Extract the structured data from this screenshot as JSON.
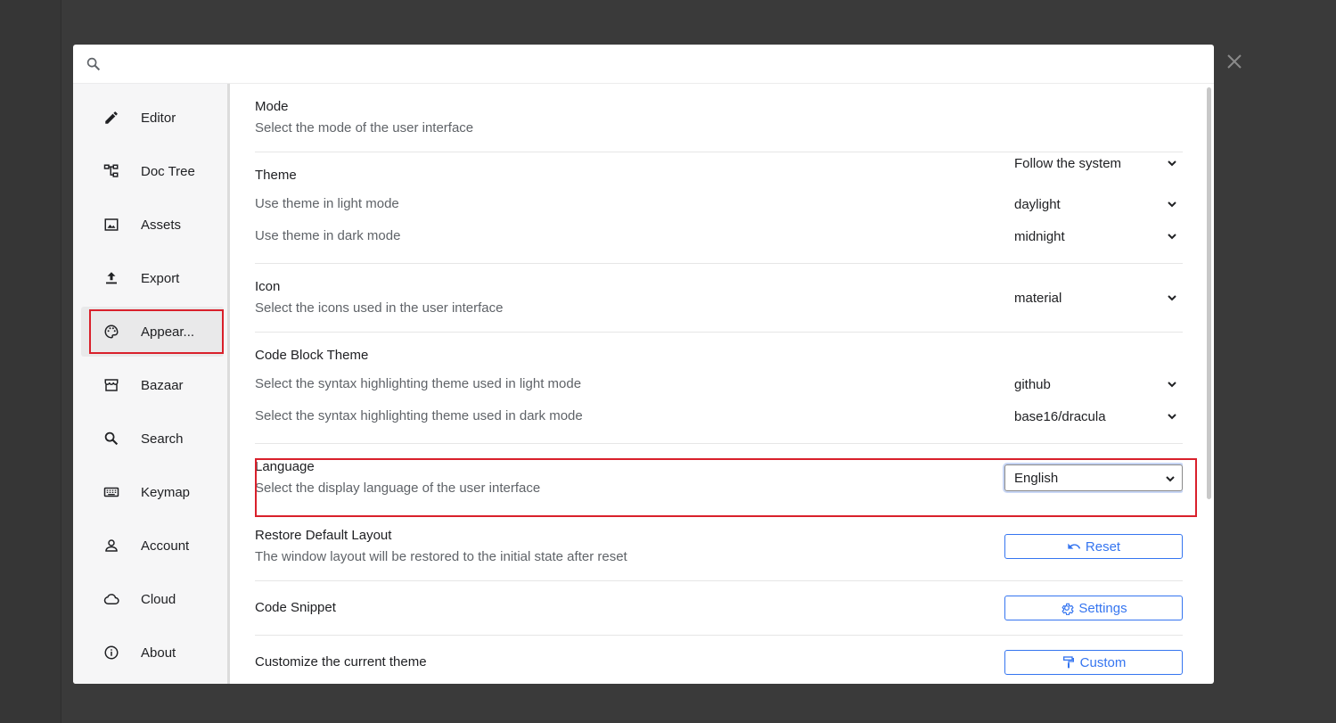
{
  "search": {
    "placeholder": ""
  },
  "sidebar": {
    "items": [
      {
        "label": "Editor",
        "icon": "pencil-icon"
      },
      {
        "label": "Doc Tree",
        "icon": "doc-tree-icon"
      },
      {
        "label": "Assets",
        "icon": "image-icon"
      },
      {
        "label": "Export",
        "icon": "export-icon"
      },
      {
        "label": "Appear...",
        "icon": "palette-icon",
        "active": true
      },
      {
        "label": "Bazaar",
        "icon": "store-icon"
      },
      {
        "label": "Search",
        "icon": "search-icon"
      },
      {
        "label": "Keymap",
        "icon": "keyboard-icon"
      },
      {
        "label": "Account",
        "icon": "account-icon"
      },
      {
        "label": "Cloud",
        "icon": "cloud-icon"
      },
      {
        "label": "About",
        "icon": "info-icon"
      }
    ]
  },
  "settings": {
    "mode": {
      "title": "Mode",
      "desc": "Select the mode of the user interface",
      "value": "Follow the system"
    },
    "theme": {
      "title": "Theme",
      "light_desc": "Use theme in light mode",
      "light_value": "daylight",
      "dark_desc": "Use theme in dark mode",
      "dark_value": "midnight"
    },
    "icon": {
      "title": "Icon",
      "desc": "Select the icons used in the user interface",
      "value": "material"
    },
    "code_block": {
      "title": "Code Block Theme",
      "light_desc": "Select the syntax highlighting theme used in light mode",
      "light_value": "github",
      "dark_desc": "Select the syntax highlighting theme used in dark mode",
      "dark_value": "base16/dracula"
    },
    "language": {
      "title": "Language",
      "desc": "Select the display language of the user interface",
      "value": "English"
    },
    "restore": {
      "title": "Restore Default Layout",
      "desc": "The window layout will be restored to the initial state after reset",
      "button": "Reset"
    },
    "snippet": {
      "title": "Code Snippet",
      "button": "Settings"
    },
    "customize": {
      "title": "Customize the current theme",
      "button": "Custom"
    }
  },
  "colors": {
    "accent": "#3575f0",
    "highlight": "#d9202b",
    "backdrop": "#3a3a3a"
  }
}
